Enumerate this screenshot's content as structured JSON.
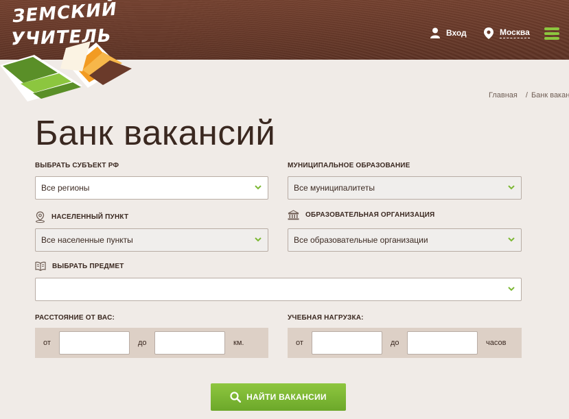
{
  "header": {
    "logo_line1": "ЗЕМСКИЙ",
    "logo_line2": "УЧИТЕЛЬ",
    "login_label": "Вход",
    "city_label": "Москва",
    "icons": [
      "user-icon",
      "location-pin-icon",
      "menu-icon"
    ],
    "accent_color": "#8cc63f",
    "background_color": "#6a3a2a"
  },
  "breadcrumb": {
    "home": "Главная",
    "separator": "/",
    "current": "Банк ваканс"
  },
  "page": {
    "title": "Банк вакансий"
  },
  "filters": {
    "region": {
      "label": "ВЫБРАТЬ СУБЪЕКТ РФ",
      "value": "Все регионы"
    },
    "municipality": {
      "label": "МУНИЦИПАЛЬНОЕ ОБРАЗОВАНИЕ",
      "value": "Все муниципалитеты"
    },
    "locality": {
      "label": "НАСЕЛЕННЫЙ ПУНКТ",
      "value": "Все населенные пункты",
      "icon": "location-outline-icon"
    },
    "organization": {
      "label": "ОБРАЗОВАТЕЛЬНАЯ ОРГАНИЗАЦИЯ",
      "value": "Все образовательные организации",
      "icon": "building-icon"
    },
    "subject": {
      "label": "ВЫБРАТЬ ПРЕДМЕТ",
      "value": "",
      "icon": "book-icon"
    },
    "distance": {
      "label": "РАССТОЯНИЕ ОТ ВАС:",
      "from": "от",
      "to": "до",
      "unit": "км."
    },
    "workload": {
      "label": "УЧЕБНАЯ НАГРУЗКА:",
      "from": "от",
      "to": "до",
      "unit": "часов"
    }
  },
  "search_button": {
    "label": "НАЙТИ ВАКАНСИИ",
    "icon": "search-icon",
    "color": "#7cb834"
  }
}
